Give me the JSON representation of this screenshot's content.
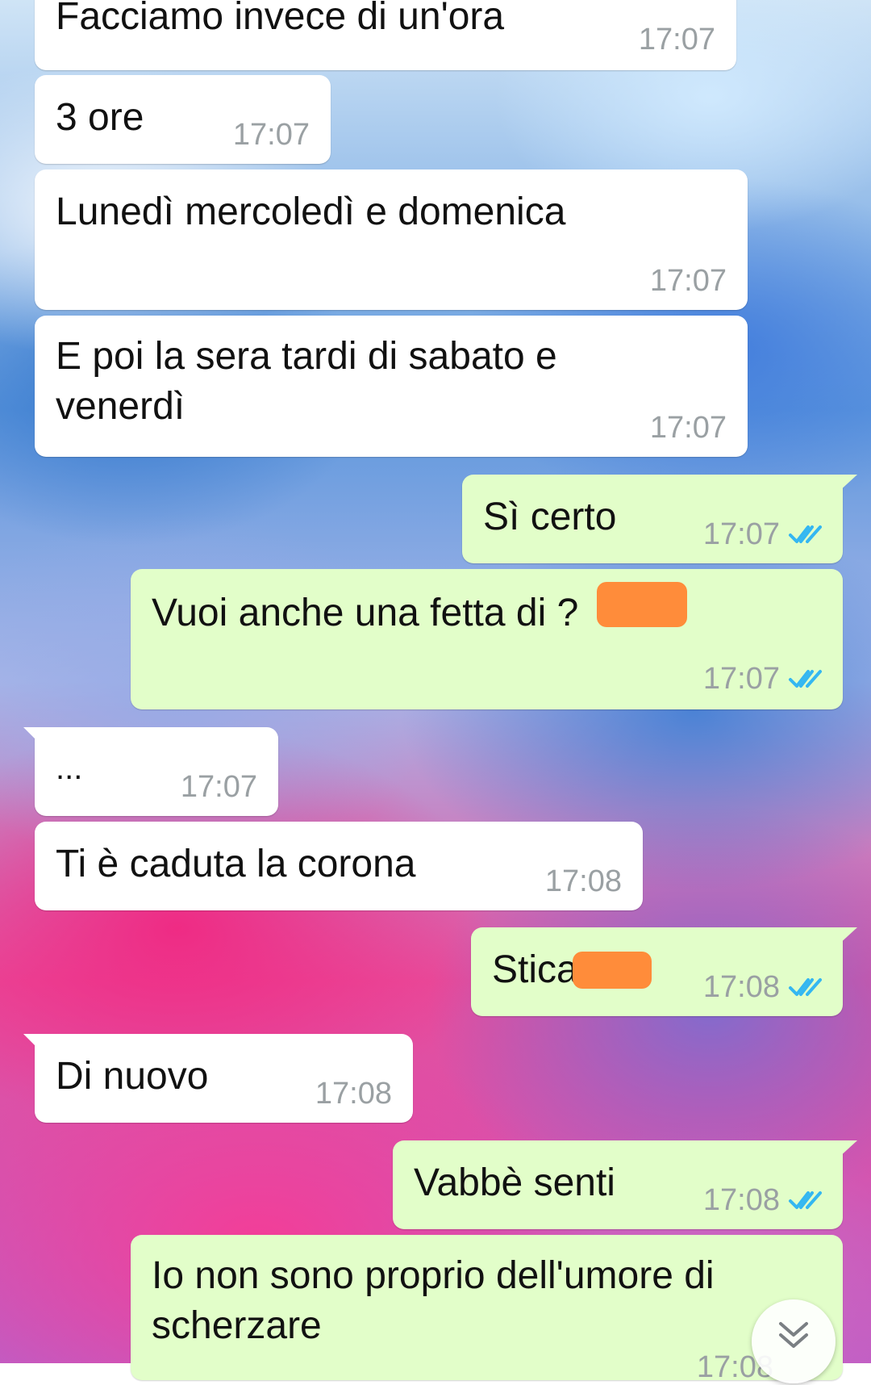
{
  "messages": [
    {
      "dir": "in",
      "text": "Facciamo invece di un'ora",
      "time": "17:07"
    },
    {
      "dir": "in",
      "text": "3 ore",
      "time": "17:07"
    },
    {
      "dir": "in",
      "text": "Lunedì mercoledì e domenica",
      "time": "17:07"
    },
    {
      "dir": "in",
      "text": "E poi la sera tardi di sabato e venerdì",
      "time": "17:07"
    },
    {
      "dir": "out",
      "text": "Sì certo",
      "time": "17:07",
      "status": "read"
    },
    {
      "dir": "out",
      "text": "Vuoi anche una fetta di      ?",
      "time": "17:07",
      "status": "read"
    },
    {
      "dir": "in",
      "text": "...",
      "time": "17:07"
    },
    {
      "dir": "in",
      "text": "Ti è caduta la corona",
      "time": "17:08"
    },
    {
      "dir": "out",
      "text": "Stica",
      "time": "17:08",
      "status": "read"
    },
    {
      "dir": "in",
      "text": "Di nuovo",
      "time": "17:08"
    },
    {
      "dir": "out",
      "text": "Vabbè senti",
      "time": "17:08",
      "status": "read"
    },
    {
      "dir": "out",
      "text": "Io non sono proprio dell'umore di scherzare",
      "time": "17:08",
      "status": "read"
    }
  ],
  "colors": {
    "incoming_bubble": "#ffffff",
    "outgoing_bubble": "#e2fec9",
    "read_ticks": "#34b7f1",
    "timestamp": "#9aa0a3",
    "redaction": "#ff8c3a"
  },
  "icons": {
    "read_receipt": "double-check-icon",
    "scroll_down": "chevron-double-down-icon"
  }
}
